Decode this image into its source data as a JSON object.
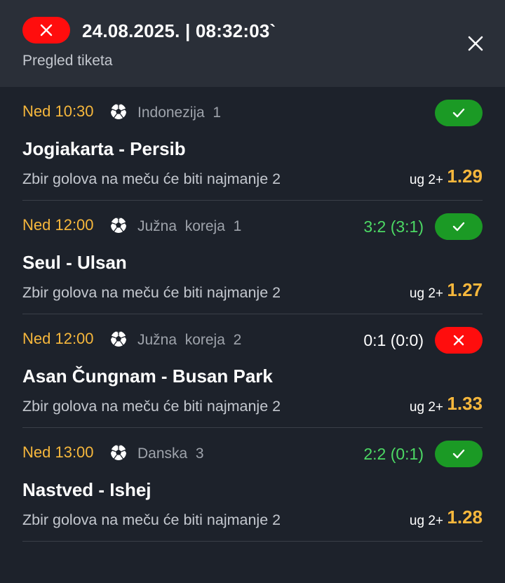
{
  "header": {
    "status_icon": "x-icon",
    "status_color": "#ff0d0d",
    "datetime": "24.08.2025. | 08:32:03`",
    "subtitle": "Pregled tiketa",
    "close_icon": "close-icon"
  },
  "colors": {
    "accent": "#f6b73c",
    "win": "#1b9a25",
    "loss": "#ff0d0d",
    "score_win": "#4cd964",
    "score_neutral": "#ffffff"
  },
  "matches": [
    {
      "time": "Ned 10:30",
      "sport_icon": "soccer-ball-icon",
      "league": "Indonezija  1",
      "score": "",
      "score_color": "#4cd964",
      "result": "won",
      "result_color": "#1b9a25",
      "teams": "Jogiakarta - Persib",
      "market": "Zbir golova na meču će biti najmanje 2",
      "pick": "ug 2+",
      "odds": "1.29"
    },
    {
      "time": "Ned 12:00",
      "sport_icon": "soccer-ball-icon",
      "league": "Južna  koreja  1",
      "score": "3:2 (3:1)",
      "score_color": "#4cd964",
      "result": "won",
      "result_color": "#1b9a25",
      "teams": "Seul - Ulsan",
      "market": "Zbir golova na meču će biti najmanje 2",
      "pick": "ug 2+",
      "odds": "1.27"
    },
    {
      "time": "Ned 12:00",
      "sport_icon": "soccer-ball-icon",
      "league": "Južna  koreja  2",
      "score": "0:1 (0:0)",
      "score_color": "#ffffff",
      "result": "lost",
      "result_color": "#ff0d0d",
      "teams": "Asan Čungnam - Busan Park",
      "market": "Zbir golova na meču će biti najmanje 2",
      "pick": "ug 2+",
      "odds": "1.33"
    },
    {
      "time": "Ned 13:00",
      "sport_icon": "soccer-ball-icon",
      "league": "Danska  3",
      "score": "2:2 (0:1)",
      "score_color": "#4cd964",
      "result": "won",
      "result_color": "#1b9a25",
      "teams": "Nastved - Ishej",
      "market": "Zbir golova na meču će biti najmanje 2",
      "pick": "ug 2+",
      "odds": "1.28"
    }
  ]
}
